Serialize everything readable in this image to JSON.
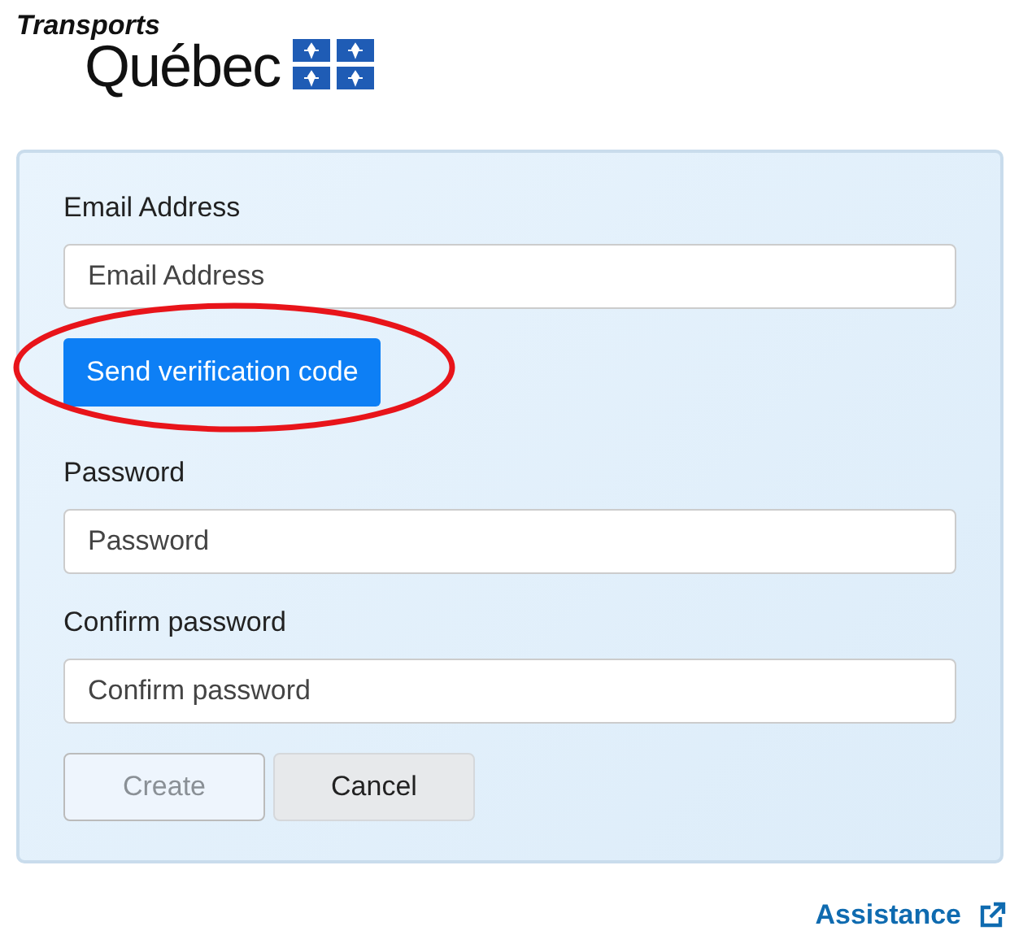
{
  "logo": {
    "line_1": "Transports",
    "line_2": "Québec"
  },
  "form": {
    "fields": [
      {
        "label": "Email Address",
        "placeholder": "Email Address",
        "kind": "email"
      },
      {
        "kind": "send_code",
        "label": "Send verification code",
        "circled": true
      },
      {
        "label": "Password",
        "placeholder": "Password",
        "kind": "password"
      },
      {
        "label": "Confirm password",
        "placeholder": "Confirm password",
        "kind": "password"
      }
    ],
    "buttons": [
      {
        "label": "Create",
        "disabled": true
      },
      {
        "label": "Cancel",
        "disabled": false
      }
    ]
  },
  "footer": {
    "link": "Assistance"
  }
}
